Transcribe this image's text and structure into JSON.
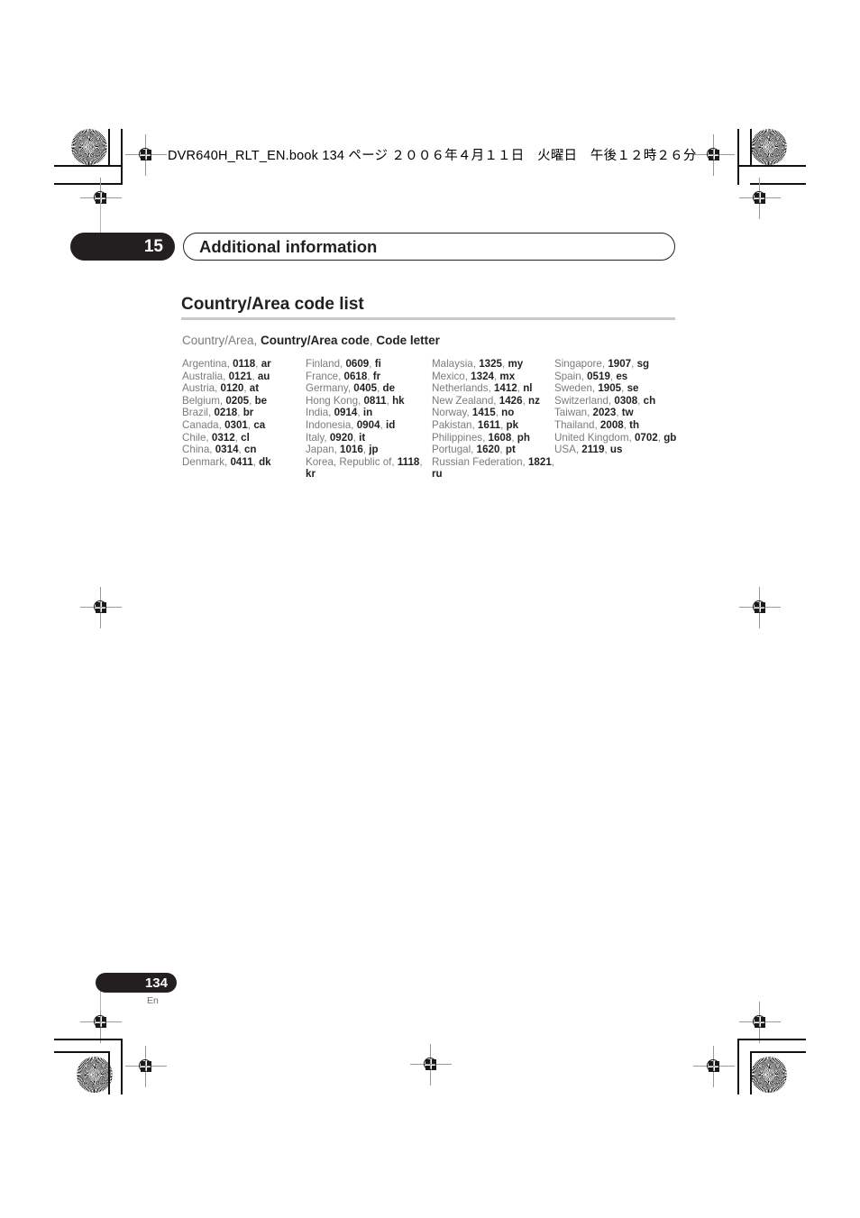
{
  "running_header": {
    "text": "DVR640H_RLT_EN.book  134 ページ  ２００６年４月１１日　火曜日　午後１２時２６分"
  },
  "chapter": {
    "number": "15",
    "title": "Additional information"
  },
  "section": {
    "heading": "Country/Area code list",
    "legend_plain_1": "Country/Area, ",
    "legend_bold_1": "Country/Area code",
    "legend_plain_2": ", ",
    "legend_bold_2": "Code letter"
  },
  "footer": {
    "page_number": "134",
    "language": "En"
  },
  "colors": {
    "ink_dark": "#231f20",
    "text_gray": "#7b7b7b",
    "rule_gray": "#c9c9c9"
  },
  "columns": [
    {
      "entries": [
        {
          "name": "Argentina,",
          "code": "0118",
          "letter": "ar"
        },
        {
          "name": "Australia,",
          "code": "0121",
          "letter": "au"
        },
        {
          "name": "Austria,",
          "code": "0120",
          "letter": "at"
        },
        {
          "name": "Belgium,",
          "code": "0205",
          "letter": "be"
        },
        {
          "name": "Brazil,",
          "code": "0218",
          "letter": "br"
        },
        {
          "name": "Canada,",
          "code": "0301",
          "letter": "ca"
        },
        {
          "name": "Chile,",
          "code": "0312",
          "letter": "cl"
        },
        {
          "name": "China,",
          "code": "0314",
          "letter": "cn"
        },
        {
          "name": "Denmark,",
          "code": "0411",
          "letter": "dk"
        }
      ]
    },
    {
      "entries": [
        {
          "name": "Finland,",
          "code": "0609",
          "letter": "fi"
        },
        {
          "name": "France,",
          "code": "0618",
          "letter": "fr"
        },
        {
          "name": "Germany,",
          "code": "0405",
          "letter": "de"
        },
        {
          "name": "Hong Kong,",
          "code": "0811",
          "letter": "hk"
        },
        {
          "name": "India,",
          "code": "0914",
          "letter": "in"
        },
        {
          "name": "Indonesia,",
          "code": "0904",
          "letter": "id"
        },
        {
          "name": "Italy,",
          "code": "0920",
          "letter": "it"
        },
        {
          "name": "Japan,",
          "code": "1016",
          "letter": "jp"
        },
        {
          "name": "Korea, Republic of,",
          "code": "1118",
          "letter": "kr"
        }
      ]
    },
    {
      "entries": [
        {
          "name": "Malaysia,",
          "code": "1325",
          "letter": "my"
        },
        {
          "name": "Mexico,",
          "code": "1324",
          "letter": "mx"
        },
        {
          "name": "Netherlands,",
          "code": "1412",
          "letter": "nl"
        },
        {
          "name": "New Zealand,",
          "code": "1426",
          "letter": "nz"
        },
        {
          "name": "Norway,",
          "code": "1415",
          "letter": "no"
        },
        {
          "name": "Pakistan,",
          "code": "1611",
          "letter": "pk"
        },
        {
          "name": "Philippines,",
          "code": "1608",
          "letter": "ph"
        },
        {
          "name": "Portugal,",
          "code": "1620",
          "letter": "pt"
        },
        {
          "name": "Russian Federation,",
          "code": "1821",
          "letter": "ru"
        }
      ]
    },
    {
      "entries": [
        {
          "name": "Singapore,",
          "code": "1907",
          "letter": "sg"
        },
        {
          "name": "Spain,",
          "code": "0519",
          "letter": "es"
        },
        {
          "name": "Sweden,",
          "code": "1905",
          "letter": "se"
        },
        {
          "name": "Switzerland,",
          "code": "0308",
          "letter": "ch"
        },
        {
          "name": "Taiwan,",
          "code": "2023",
          "letter": "tw"
        },
        {
          "name": "Thailand,",
          "code": "2008",
          "letter": "th"
        },
        {
          "name": "United Kingdom,",
          "code": "0702",
          "letter": "gb"
        },
        {
          "name": "USA,",
          "code": "2119",
          "letter": "us"
        }
      ]
    }
  ]
}
